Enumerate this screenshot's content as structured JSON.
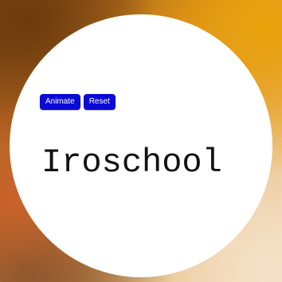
{
  "controls": {
    "animate_label": "Animate",
    "reset_label": "Reset",
    "button_color": "#0a0ad6"
  },
  "title": "Iroschool"
}
